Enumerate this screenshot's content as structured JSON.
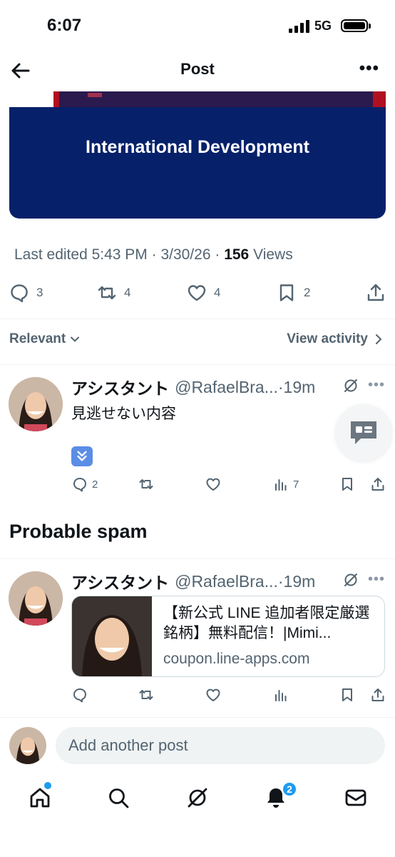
{
  "status": {
    "time": "6:07",
    "network": "5G"
  },
  "header": {
    "title": "Post"
  },
  "media": {
    "caption": "International Development"
  },
  "meta": {
    "edited_prefix": "Last edited 5:43 PM · 3/30/26",
    "views_count": "156",
    "views_label": "Views"
  },
  "actions": {
    "replies": "3",
    "reposts": "4",
    "likes": "4",
    "bookmarks": "2"
  },
  "sort": {
    "label": "Relevant",
    "view_activity": "View activity"
  },
  "replies": [
    {
      "name": "アシスタント",
      "handle": "@RafaelBra...",
      "time": "·19m",
      "text": "見逃せない内容",
      "emoji": "down-arrow-emoji",
      "replies": "2",
      "views": "7"
    },
    {
      "name": "アシスタント",
      "handle": "@RafaelBra...",
      "time": "·19m",
      "link_title": "【新公式 LINE 追加者限定厳選銘柄】無料配信！|Mimi...",
      "link_domain": "coupon.line-apps.com"
    }
  ],
  "spam_section": {
    "title": "Probable spam"
  },
  "composer": {
    "placeholder": "Add another post"
  },
  "tabbar": {
    "notifications_badge": "2"
  },
  "colors": {
    "accent": "#1d9bf0",
    "secondary_text": "#536471",
    "media_bg": "#06216a"
  }
}
